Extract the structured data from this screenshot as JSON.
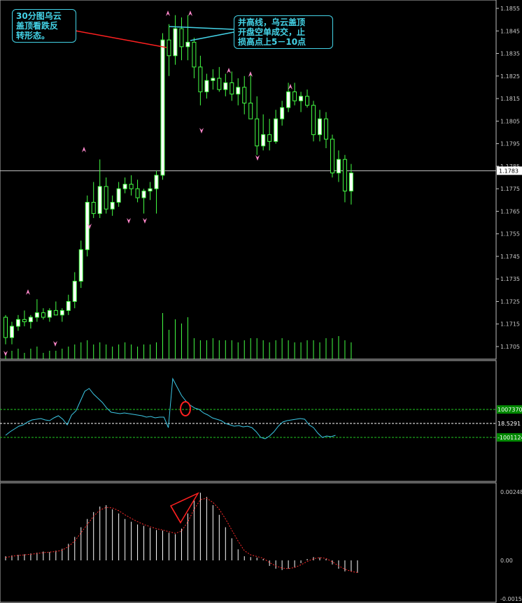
{
  "annotations": {
    "left_note": "30分图乌云\n盖顶看跌反\n转形态。",
    "right_note": "并高线，乌云盖顶\n开盘空单成交，止\n损高点上5－10点"
  },
  "price_panel": {
    "current_price_label": "1.1783",
    "y_ticks": [
      "1.1855",
      "1.1845",
      "1.1835",
      "1.1825",
      "1.1815",
      "1.1805",
      "1.1795",
      "1.1785",
      "1.1775",
      "1.1765",
      "1.1755",
      "1.1745",
      "1.1735",
      "1.1725",
      "1.1715",
      "1.1705"
    ]
  },
  "osc_panel": {
    "upper_level_label": "1007370",
    "middle_label": "18.5291",
    "lower_level_label": "-1001124"
  },
  "macd_panel": {
    "y_ticks": [
      "0.00248",
      "0.00",
      "-0.00157"
    ]
  },
  "colors": {
    "background": "#000000",
    "up_candle": "#ffffff",
    "candle_outline": "#44ff44",
    "volume": "#44ff44",
    "fractal": "#ff88cc",
    "oscillator_line": "#3cc8e6",
    "level_line": "#22cc22",
    "macd_hist": "#ffffff",
    "macd_signal": "#ff2a2a",
    "annotation": "#44d4e8",
    "arrow_red": "#ff2020"
  },
  "chart_data": [
    {
      "type": "candlestick",
      "title": "",
      "ylim": [
        1.1702,
        1.1858
      ],
      "ohlc": [
        [
          1.1718,
          1.1719,
          1.1706,
          1.1709
        ],
        [
          1.1709,
          1.1716,
          1.1706,
          1.1714
        ],
        [
          1.1714,
          1.1719,
          1.1712,
          1.1717
        ],
        [
          1.1717,
          1.1721,
          1.1714,
          1.1716
        ],
        [
          1.1716,
          1.1719,
          1.1713,
          1.1718
        ],
        [
          1.1718,
          1.1726,
          1.1716,
          1.172
        ],
        [
          1.172,
          1.1722,
          1.1717,
          1.1718
        ],
        [
          1.1718,
          1.1722,
          1.1716,
          1.1721
        ],
        [
          1.1721,
          1.1725,
          1.1719,
          1.1719
        ],
        [
          1.1719,
          1.1722,
          1.1716,
          1.1721
        ],
        [
          1.1721,
          1.1728,
          1.1719,
          1.1725
        ],
        [
          1.1725,
          1.1738,
          1.1722,
          1.1734
        ],
        [
          1.1734,
          1.1752,
          1.1731,
          1.1748
        ],
        [
          1.1748,
          1.1772,
          1.1745,
          1.1769
        ],
        [
          1.1769,
          1.1778,
          1.1762,
          1.1764
        ],
        [
          1.1764,
          1.1788,
          1.1762,
          1.1776
        ],
        [
          1.1776,
          1.178,
          1.1764,
          1.1766
        ],
        [
          1.1766,
          1.1772,
          1.1763,
          1.1769
        ],
        [
          1.1769,
          1.1778,
          1.1767,
          1.1775
        ],
        [
          1.1775,
          1.178,
          1.1773,
          1.1777
        ],
        [
          1.1777,
          1.1781,
          1.1772,
          1.1775
        ],
        [
          1.1775,
          1.1779,
          1.1769,
          1.1771
        ],
        [
          1.1771,
          1.1775,
          1.1764,
          1.1774
        ],
        [
          1.1774,
          1.1778,
          1.177,
          1.1775
        ],
        [
          1.1775,
          1.1783,
          1.1764,
          1.1781
        ],
        [
          1.1781,
          1.1844,
          1.1779,
          1.1841
        ],
        [
          1.1841,
          1.1848,
          1.1825,
          1.1834
        ],
        [
          1.1834,
          1.1852,
          1.183,
          1.1846
        ],
        [
          1.1846,
          1.1851,
          1.1832,
          1.1838
        ],
        [
          1.1838,
          1.1852,
          1.1832,
          1.184
        ],
        [
          1.184,
          1.1842,
          1.1824,
          1.1829
        ],
        [
          1.1829,
          1.1834,
          1.1812,
          1.1818
        ],
        [
          1.1818,
          1.1826,
          1.1815,
          1.1823
        ],
        [
          1.1823,
          1.1828,
          1.1819,
          1.1824
        ],
        [
          1.1824,
          1.1829,
          1.1818,
          1.1819
        ],
        [
          1.1819,
          1.1826,
          1.1816,
          1.1822
        ],
        [
          1.1822,
          1.1827,
          1.1814,
          1.1817
        ],
        [
          1.1817,
          1.1824,
          1.1812,
          1.182
        ],
        [
          1.182,
          1.1825,
          1.1808,
          1.1813
        ],
        [
          1.1813,
          1.1826,
          1.1808,
          1.1806
        ],
        [
          1.1806,
          1.1816,
          1.179,
          1.1794
        ],
        [
          1.1794,
          1.1808,
          1.1792,
          1.1799
        ],
        [
          1.1799,
          1.1806,
          1.1792,
          1.1796
        ],
        [
          1.1796,
          1.181,
          1.1795,
          1.1806
        ],
        [
          1.1806,
          1.1814,
          1.1803,
          1.1811
        ],
        [
          1.1811,
          1.1822,
          1.1809,
          1.1818
        ],
        [
          1.1818,
          1.1822,
          1.1812,
          1.1814
        ],
        [
          1.1814,
          1.1818,
          1.1809,
          1.1816
        ],
        [
          1.1816,
          1.1819,
          1.1811,
          1.1812
        ],
        [
          1.1812,
          1.1814,
          1.1796,
          1.1799
        ],
        [
          1.1799,
          1.181,
          1.1796,
          1.1806
        ],
        [
          1.1806,
          1.1809,
          1.1793,
          1.1797
        ],
        [
          1.1797,
          1.1799,
          1.178,
          1.1782
        ],
        [
          1.1782,
          1.1792,
          1.1778,
          1.1788
        ],
        [
          1.1788,
          1.179,
          1.1769,
          1.1774
        ],
        [
          1.1774,
          1.1786,
          1.1768,
          1.1782
        ]
      ],
      "fractals_up": [
        5,
        16,
        30,
        32,
        44,
        48,
        59
      ],
      "fractals_down": [
        0,
        13,
        17,
        28,
        29,
        39,
        49,
        64
      ],
      "current_price": 1.1783,
      "volume": [
        3,
        4,
        5,
        3,
        5,
        6,
        3,
        4,
        4,
        5,
        6,
        7,
        8,
        9,
        7,
        8,
        7,
        6,
        7,
        8,
        7,
        6,
        7,
        7,
        8,
        22,
        14,
        19,
        17,
        20,
        10,
        9,
        9,
        10,
        9,
        9,
        9,
        8,
        9,
        10,
        10,
        9,
        8,
        9,
        10,
        9,
        8,
        8,
        9,
        9,
        8,
        10,
        10,
        11,
        9,
        8
      ]
    },
    {
      "type": "line",
      "title": "",
      "levels": [
        100,
        -100
      ],
      "ylim": [
        -230,
        345
      ],
      "values": [
        -85,
        -60,
        -40,
        -20,
        -10,
        10,
        25,
        30,
        35,
        25,
        20,
        40,
        55,
        30,
        -10,
        60,
        90,
        160,
        230,
        250,
        210,
        180,
        150,
        110,
        80,
        75,
        70,
        75,
        70,
        65,
        60,
        55,
        45,
        50,
        40,
        45,
        45,
        -30,
        320,
        260,
        200,
        160,
        130,
        110,
        100,
        75,
        60,
        40,
        30,
        20,
        0,
        -10,
        -20,
        -15,
        -25,
        -20,
        -30,
        -60,
        -100,
        -110,
        -90,
        -60,
        -20,
        10,
        20,
        25,
        30,
        35,
        30,
        -10,
        -30,
        -70,
        -100,
        -90,
        -95,
        -85
      ]
    },
    {
      "type": "bar",
      "title": "",
      "ylim": [
        -0.00157,
        0.00248
      ],
      "values": [
        0.00015,
        0.00018,
        0.0002,
        0.00022,
        0.00025,
        0.00028,
        0.00032,
        0.0003,
        0.00035,
        0.00042,
        0.0006,
        0.00085,
        0.0012,
        0.0015,
        0.00175,
        0.00195,
        0.002,
        0.00185,
        0.0017,
        0.0015,
        0.0014,
        0.0013,
        0.00125,
        0.00118,
        0.0011,
        0.00108,
        0.001,
        0.00095,
        0.00115,
        0.0017,
        0.00218,
        0.00245,
        0.0023,
        0.002,
        0.00165,
        0.0012,
        0.0008,
        0.0004,
        0.00015,
        0.00012,
        0.0001,
        5e-05,
        -0.0002,
        -0.0003,
        -0.00035,
        -0.0003,
        -0.00025,
        -0.0001,
        5e-05,
        0.00012,
        0.0001,
        5e-05,
        -0.00015,
        -0.0003,
        -0.0004,
        -0.0004,
        -0.00045
      ],
      "signal": [
        0.0001,
        0.00015,
        0.00018,
        0.0002,
        0.00022,
        0.00025,
        0.00028,
        0.0003,
        0.00032,
        0.00037,
        0.0005,
        0.0007,
        0.001,
        0.0013,
        0.0016,
        0.00182,
        0.00192,
        0.0019,
        0.0018,
        0.00165,
        0.00152,
        0.0014,
        0.0013,
        0.00122,
        0.00115,
        0.0011,
        0.00104,
        0.00098,
        0.00106,
        0.0014,
        0.00185,
        0.0022,
        0.00225,
        0.0021,
        0.00185,
        0.0015,
        0.0011,
        0.0007,
        0.00035,
        0.0002,
        0.00014,
        8e-05,
        -8e-05,
        -0.0002,
        -0.00028,
        -0.0003,
        -0.00026,
        -0.00016,
        -4e-05,
        6e-05,
        0.0001,
        7e-05,
        -5e-05,
        -0.0002,
        -0.00032,
        -0.0004,
        -0.00044
      ]
    }
  ]
}
